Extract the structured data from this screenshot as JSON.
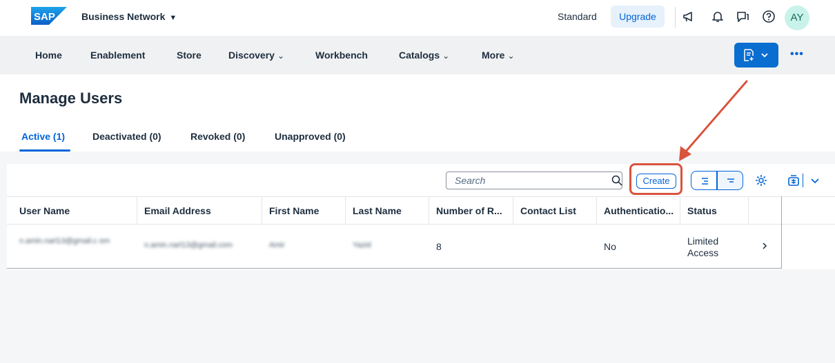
{
  "shell": {
    "logo_text": "SAP",
    "product_name": "Business Network",
    "standard_label": "Standard",
    "upgrade_label": "Upgrade",
    "avatar_initials": "AY"
  },
  "nav": {
    "items": [
      {
        "label": "Home"
      },
      {
        "label": "Enablement"
      },
      {
        "label": "Store"
      },
      {
        "label": "Discovery"
      },
      {
        "label": "Workbench"
      },
      {
        "label": "Catalogs"
      },
      {
        "label": "More"
      }
    ]
  },
  "page": {
    "title": "Manage Users",
    "tabs": [
      {
        "label": "Active (1)"
      },
      {
        "label": "Deactivated (0)"
      },
      {
        "label": "Revoked (0)"
      },
      {
        "label": "Unapproved (0)"
      }
    ]
  },
  "toolbar": {
    "search_placeholder": "Search",
    "create_label": "Create"
  },
  "table": {
    "columns": [
      "User Name",
      "Email Address",
      "First Name",
      "Last Name",
      "Number of R...",
      "Contact List",
      "Authenticatio...",
      "Status"
    ],
    "rows": [
      {
        "user_name": "n.amin.narl13@gmail.c om",
        "email": "n.amin.narl13@gmail.com",
        "first_name": "Amir",
        "last_name": "Yazid",
        "number_of_roles": "8",
        "contact_list": "",
        "authentication": "No",
        "status_line1": "Limited",
        "status_line2": "Access"
      }
    ]
  },
  "colors": {
    "accent": "#0064d9",
    "highlight": "#d9533d"
  }
}
